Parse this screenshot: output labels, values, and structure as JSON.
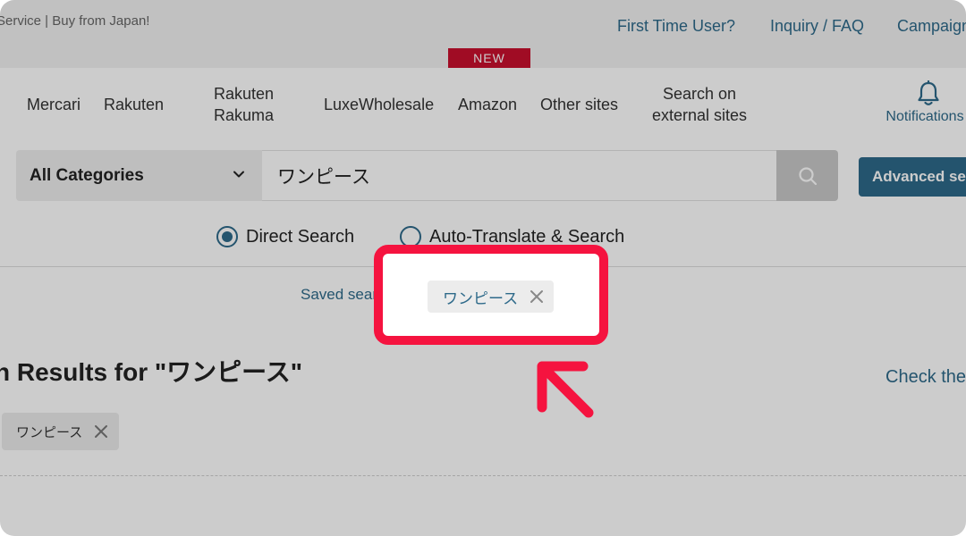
{
  "header": {
    "tagline": "Service | Buy from Japan!",
    "links": [
      "First Time User?",
      "Inquiry / FAQ",
      "Campaign"
    ],
    "new_badge": "NEW"
  },
  "nav": {
    "items": [
      "Mercari",
      "Rakuten",
      "Rakuten Rakuma",
      "LuxeWholesale",
      "Amazon",
      "Other sites",
      "Search on external sites"
    ],
    "notifications_label": "Notifications"
  },
  "search": {
    "category": "All Categories",
    "query": "ワンピース",
    "advanced_label": "Advanced se",
    "options": [
      "Direct Search",
      "Auto-Translate & Search"
    ],
    "selected_option": "Direct Search"
  },
  "saved": {
    "link_label": "Saved search",
    "tag": "ワンピース"
  },
  "results": {
    "heading": "n Results for \"ワンピース\"",
    "check_link": "Check the",
    "filter_tag": "ワンピース"
  },
  "colors": {
    "accent": "#2e6a8a",
    "highlight": "#f5133f",
    "badge": "#c8102e"
  }
}
